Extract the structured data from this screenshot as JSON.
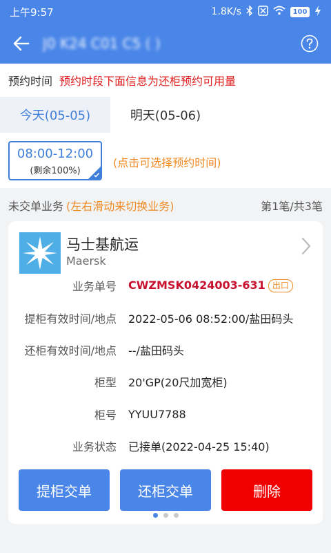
{
  "status_bar": {
    "time": "上午9:57",
    "network_speed": "1.8K/s",
    "battery": "100"
  },
  "app_bar": {
    "title": "J0 K24 C01 C5 ( )"
  },
  "notice": {
    "label": "预约时间",
    "message": "预约时段下面信息为还柜预约可用量"
  },
  "day_tabs": [
    {
      "label": "今天(05-05)",
      "active": true
    },
    {
      "label": "明天(05-06)",
      "active": false
    }
  ],
  "time_slot": {
    "time": "08:00-12:00",
    "remaining": "(剩余100%)",
    "hint": "(点击可选择预约时间)"
  },
  "section": {
    "title": "未交单业务",
    "hint": "(左右滑动来切换业务)",
    "page": "第1笔/共3笔"
  },
  "card": {
    "company_cn": "马士基航运",
    "company_en": "Maersk",
    "rows": [
      {
        "label": "业务单号",
        "value": "CWZMSK0424003-631",
        "tag": "出口"
      },
      {
        "label": "提柜有效时间/地点",
        "value": "2022-05-06 08:52:00/盐田码头"
      },
      {
        "label": "还柜有效时间/地点",
        "value": "--/盐田码头"
      },
      {
        "label": "柜型",
        "value": "20'GP(20尺加宽柜)"
      },
      {
        "label": "柜号",
        "value": "YYUU7788"
      },
      {
        "label": "业务状态",
        "value": "已接单(2022-04-25 15:40)"
      }
    ],
    "buttons": {
      "pickup": "提柜交单",
      "return": "还柜交单",
      "delete": "删除"
    }
  },
  "pager": {
    "current": 1,
    "total": 3
  },
  "colors": {
    "primary": "#4a86e8",
    "accent_orange": "#f08a24",
    "danger": "#f00000",
    "highlight_red": "#c8102e"
  },
  "icons": {
    "back": "arrow-left-icon",
    "help": "question-circle-icon",
    "chevron": "chevron-right-icon",
    "logo": "maersk-star-logo",
    "selected": "check-corner-icon"
  }
}
